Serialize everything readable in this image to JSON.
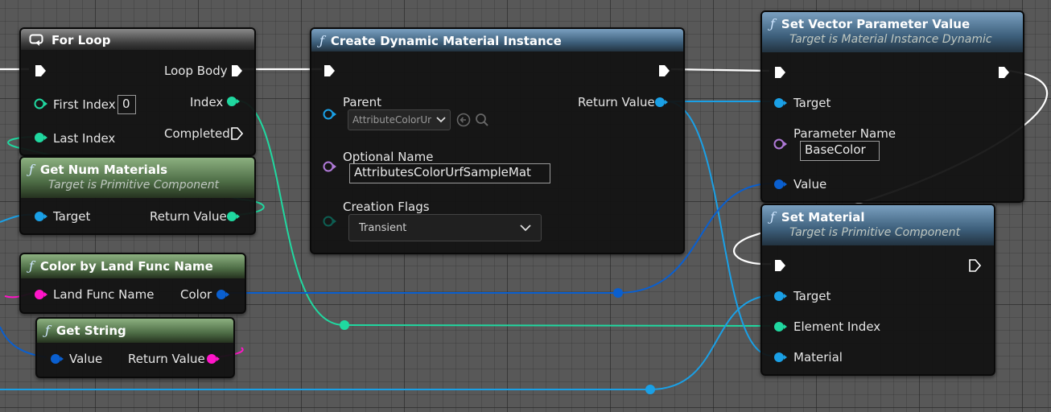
{
  "colors": {
    "exec": "#ffffff",
    "int": "#20d8a0",
    "object": "#1aa0e6",
    "struct": "#0a5fcf",
    "string": "#ff15c8",
    "name": "#b07ad8",
    "flags": "#0d5e52"
  },
  "nodes": {
    "for_loop": {
      "icon": "loop-icon",
      "title": "For Loop",
      "first_index_label": "First Index",
      "first_index_value": "0",
      "last_index_label": "Last Index",
      "loop_body_label": "Loop Body",
      "index_label": "Index",
      "completed_label": "Completed"
    },
    "get_num_materials": {
      "title": "Get Num Materials",
      "subtitle": "Target is Primitive Component",
      "target_label": "Target",
      "return_label": "Return Value"
    },
    "color_by_land": {
      "title": "Color by Land Func Name",
      "land_label": "Land Func Name",
      "color_label": "Color"
    },
    "get_string": {
      "title": "Get String",
      "value_label": "Value",
      "return_label": "Return Value"
    },
    "create_dmi": {
      "title": "Create Dynamic Material Instance",
      "parent_label": "Parent",
      "parent_value": "AttributeColorUr",
      "optional_name_label": "Optional Name",
      "optional_name_value": "AttributesColorUrfSampleMat",
      "flags_label": "Creation Flags",
      "flags_value": "Transient",
      "return_label": "Return Value"
    },
    "set_vector": {
      "title": "Set Vector Parameter Value",
      "subtitle": "Target is Material Instance Dynamic",
      "target_label": "Target",
      "param_label": "Parameter Name",
      "param_value": "BaseColor",
      "value_label": "Value"
    },
    "set_material": {
      "title": "Set Material",
      "subtitle": "Target is Primitive Component",
      "target_label": "Target",
      "element_label": "Element Index",
      "material_label": "Material"
    }
  }
}
